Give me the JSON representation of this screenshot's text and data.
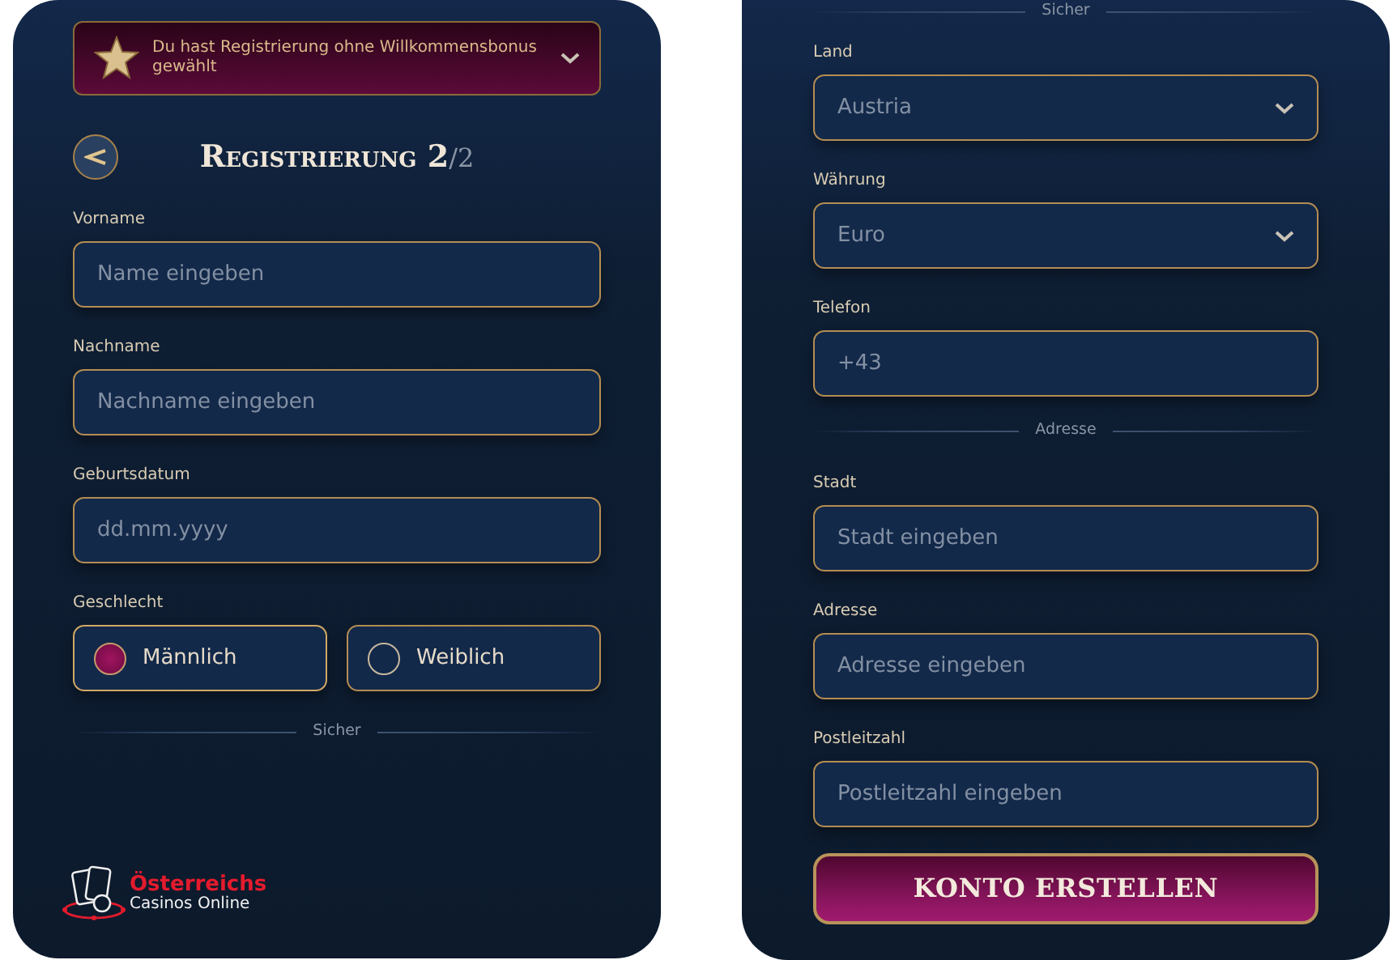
{
  "bonus_banner": {
    "text": "Du hast Registrierung ohne Willkommensbonus gewählt"
  },
  "title": {
    "main": "Registrierung 2",
    "suffix": "/2"
  },
  "left_fields": [
    {
      "kind": "input",
      "label": "Vorname",
      "placeholder": "Name eingeben"
    },
    {
      "kind": "input",
      "label": "Nachname",
      "placeholder": "Nachname eingeben"
    },
    {
      "kind": "input",
      "label": "Geburtsdatum",
      "placeholder": "dd.mm.yyyy"
    },
    {
      "kind": "radio",
      "label": "Geschlecht",
      "options": [
        {
          "label": "Männlich",
          "selected": true
        },
        {
          "label": "Weiblich",
          "selected": false
        }
      ]
    },
    {
      "kind": "divider",
      "label": "Sicher"
    }
  ],
  "logo": {
    "line1": "Österreichs",
    "line2": "Casinos Online"
  },
  "right_fields": [
    {
      "kind": "divider",
      "label": "Sicher"
    },
    {
      "kind": "select",
      "label": "Land",
      "value": "Austria"
    },
    {
      "kind": "select",
      "label": "Währung",
      "value": "Euro"
    },
    {
      "kind": "input",
      "label": "Telefon",
      "placeholder": "+43"
    },
    {
      "kind": "divider",
      "label": "Adresse"
    },
    {
      "kind": "input",
      "label": "Stadt",
      "placeholder": "Stadt eingeben"
    },
    {
      "kind": "input",
      "label": "Adresse",
      "placeholder": "Adresse eingeben"
    },
    {
      "kind": "input",
      "label": "Postleitzahl",
      "placeholder": "Postleitzahl eingeben"
    }
  ],
  "submit_button": "KONTO ERSTELLEN"
}
